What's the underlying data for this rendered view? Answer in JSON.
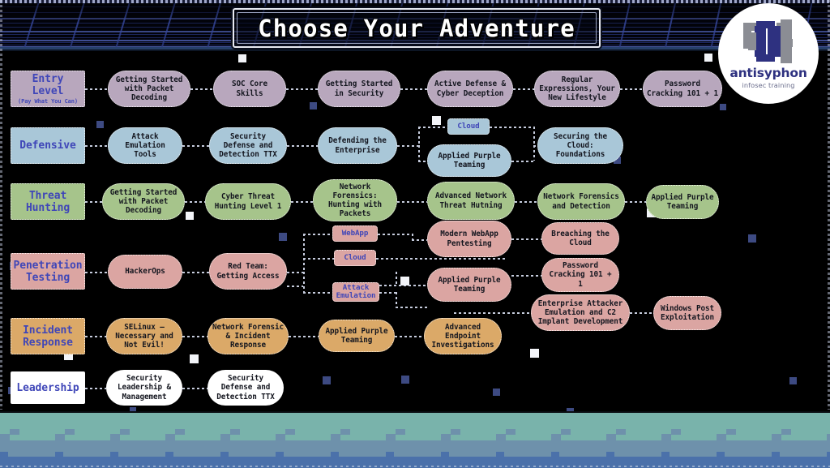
{
  "header": {
    "title": "Choose Your Adventure",
    "logo": {
      "name": "antisyphon",
      "tagline": "infosec training"
    }
  },
  "colors": {
    "entry": "#b8a7bd",
    "defensive": "#a9c7d8",
    "threat_hunting": "#a6c48b",
    "penetration_testing": "#dba5a2",
    "incident_response": "#dba968",
    "leadership": "#ffffff",
    "label_text": "#3f46b8",
    "node_text": "#14161f",
    "background": "#000000",
    "connector": "#c6ccdd",
    "ground_top": "#79b3ab",
    "ground_mid": "#6e91ab",
    "ground_bottom": "#4b71aa",
    "grid": "#3b4da8"
  },
  "tracks": [
    {
      "id": "entry-level",
      "label": "Entry Level",
      "sublabel": "(Pay What You Can)",
      "color_key": "entry",
      "courses": [
        "Getting Started with Packet Decoding",
        "SOC Core Skills",
        "Getting Started in Security",
        "Active Defense & Cyber Deception",
        "Regular Expressions, Your New Lifestyle",
        "Password Cracking 101 + 1"
      ]
    },
    {
      "id": "defensive",
      "label": "Defensive",
      "sublabel": "",
      "color_key": "defensive",
      "courses": [
        "Attack Emulation Tools",
        "Security Defense and Detection TTX",
        "Defending the Enterprise",
        "Applied Purple Teaming",
        "Securing the Cloud: Foundations"
      ],
      "tags": [
        "Cloud"
      ]
    },
    {
      "id": "threat-hunting",
      "label": "Threat Hunting",
      "sublabel": "",
      "color_key": "threat_hunting",
      "courses": [
        "Getting Started with Packet Decoding",
        "Cyber Threat Hunting Level 1",
        "Network Forensics: Hunting with Packets",
        "Advanced Network Threat Hutning",
        "Network Forensics and Detection",
        "Applied Purple Teaming"
      ]
    },
    {
      "id": "penetration-testing",
      "label": "Penetration Testing",
      "sublabel": "",
      "color_key": "penetration_testing",
      "courses": [
        "HackerOps",
        "Red Team: Getting Access",
        "Modern WebApp Pentesting",
        "Breaching the Cloud",
        "Applied Purple Teaming",
        "Password Cracking 101 + 1",
        "Enterprise Attacker Emulation and C2 Implant Development",
        "Windows Post Exploitation"
      ],
      "tags": [
        "WebApp",
        "Cloud",
        "Attack Emulation"
      ]
    },
    {
      "id": "incident-response",
      "label": "Incident Response",
      "sublabel": "",
      "color_key": "incident_response",
      "courses": [
        "SELinux – Necessary and Not Evil!",
        "Network Forensic & Incident Response",
        "Applied Purple Teaming",
        "Advanced Endpoint Investigations"
      ]
    },
    {
      "id": "leadership",
      "label": "Leadership",
      "sublabel": "",
      "color_key": "leadership",
      "courses": [
        "Security Leadership & Management",
        "Security Defense and Detection TTX"
      ]
    }
  ],
  "nodes": {
    "e_cat": "Entry Level",
    "e_sub": "(Pay What You Can)",
    "e1": "Getting Started with Packet Decoding",
    "e2": "SOC Core Skills",
    "e3": "Getting Started in Security",
    "e4": "Active Defense & Cyber Deception",
    "e5": "Regular Expressions, Your New Lifestyle",
    "e6": "Password Cracking 101 + 1",
    "d_cat": "Defensive",
    "d1": "Attack Emulation Tools",
    "d2": "Security Defense and Detection TTX",
    "d3": "Defending the Enterprise",
    "d_tag_cloud": "Cloud",
    "d4": "Applied Purple Teaming",
    "d5": "Securing the Cloud: Foundations",
    "t_cat": "Threat Hunting",
    "t1": "Getting Started with Packet Decoding",
    "t2": "Cyber Threat Hunting Level 1",
    "t3": "Network Forensics: Hunting with Packets",
    "t4": "Advanced Network Threat Hutning",
    "t5": "Network Forensics and Detection",
    "t6": "Applied Purple Teaming",
    "p_cat": "Penetration Testing",
    "p1": "HackerOps",
    "p2": "Red Team: Getting Access",
    "p_tag_webapp": "WebApp",
    "p_tag_cloud": "Cloud",
    "p_tag_attack": "Attack Emulation",
    "p3": "Modern WebApp Pentesting",
    "p4": "Breaching the Cloud",
    "p5": "Applied Purple Teaming",
    "p6": "Password Cracking 101 + 1",
    "p7": "Enterprise Attacker Emulation and C2 Implant Development",
    "p8": "Windows Post Exploitation",
    "i_cat": "Incident Response",
    "i1": "SELinux – Necessary and Not Evil!",
    "i2": "Network Forensic & Incident Response",
    "i3": "Applied Purple Teaming",
    "i4": "Advanced Endpoint Investigations",
    "l_cat": "Leadership",
    "l1": "Security Leadership & Management",
    "l2": "Security Defense and Detection TTX"
  }
}
